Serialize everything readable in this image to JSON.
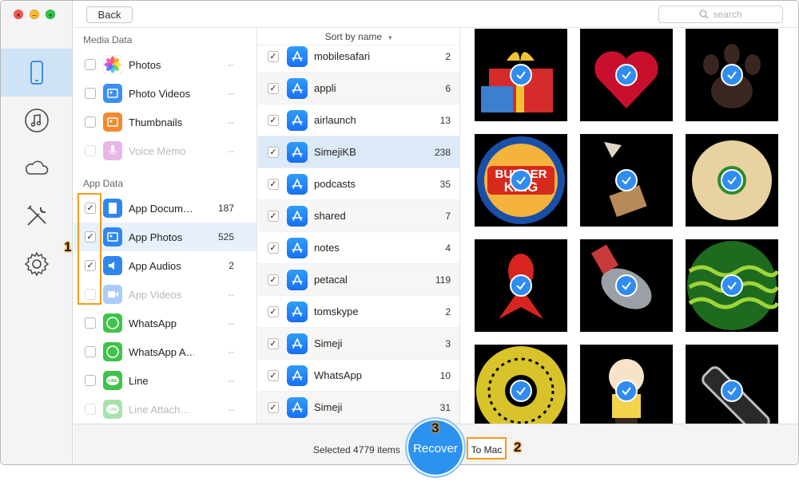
{
  "window": {
    "traffic_lights": [
      "close",
      "minimize",
      "maximize"
    ]
  },
  "sidebar": {
    "items": [
      {
        "name": "device-icon",
        "active": true
      },
      {
        "name": "music-icon",
        "active": false
      },
      {
        "name": "cloud-icon",
        "active": false
      },
      {
        "name": "tools-icon",
        "active": false
      },
      {
        "name": "settings-icon",
        "active": false
      }
    ]
  },
  "toolbar": {
    "back_label": "Back",
    "search_placeholder": "search"
  },
  "categories": {
    "media_header": "Media Data",
    "app_header": "App Data",
    "media": [
      {
        "label": "Photos",
        "count": "--",
        "checked": false,
        "dim": false,
        "icon": "photos-icon",
        "color": "#ffffff"
      },
      {
        "label": "Photo Videos",
        "count": "--",
        "checked": false,
        "dim": false,
        "icon": "photo-videos-icon",
        "color": "#3a8ff0"
      },
      {
        "label": "Thumbnails",
        "count": "--",
        "checked": false,
        "dim": false,
        "icon": "thumbnails-icon",
        "color": "#f28a2e"
      },
      {
        "label": "Voice Memo",
        "count": "--",
        "checked": false,
        "dim": true,
        "icon": "voice-memo-icon",
        "color": "#e9b6e8"
      }
    ],
    "app": [
      {
        "label": "App Docum…",
        "count": "187",
        "checked": true,
        "dim": false,
        "icon": "app-documents-icon",
        "color": "#2f87ee"
      },
      {
        "label": "App Photos",
        "count": "525",
        "checked": true,
        "dim": false,
        "icon": "app-photos-icon",
        "color": "#2f87ee",
        "selected": true
      },
      {
        "label": "App Audios",
        "count": "2",
        "checked": true,
        "dim": false,
        "icon": "app-audios-icon",
        "color": "#2f87ee"
      },
      {
        "label": "App Videos",
        "count": "--",
        "checked": false,
        "dim": true,
        "icon": "app-videos-icon",
        "color": "#a9cdf6"
      },
      {
        "label": "WhatsApp",
        "count": "--",
        "checked": false,
        "dim": false,
        "icon": "whatsapp-icon",
        "color": "#3ec34b"
      },
      {
        "label": "WhatsApp A…",
        "count": "--",
        "checked": false,
        "dim": false,
        "icon": "whatsapp-attachments-icon",
        "color": "#3ec34b"
      },
      {
        "label": "Line",
        "count": "--",
        "checked": false,
        "dim": false,
        "icon": "line-icon",
        "color": "#3ec34b"
      },
      {
        "label": "Line Attach…",
        "count": "--",
        "checked": false,
        "dim": true,
        "icon": "line-attachments-icon",
        "color": "#a8e2ad"
      }
    ]
  },
  "list": {
    "sort_label": "Sort by name",
    "rows": [
      {
        "name": "mobilesafari",
        "count": "2"
      },
      {
        "name": "appli",
        "count": "6"
      },
      {
        "name": "airlaunch",
        "count": "13"
      },
      {
        "name": "SimejiKB",
        "count": "238",
        "selected": true
      },
      {
        "name": "podcasts",
        "count": "35"
      },
      {
        "name": "shared",
        "count": "7"
      },
      {
        "name": "notes",
        "count": "4"
      },
      {
        "name": "petacal",
        "count": "119"
      },
      {
        "name": "tomskype",
        "count": "2"
      },
      {
        "name": "Simeji",
        "count": "3"
      },
      {
        "name": "WhatsApp",
        "count": "10"
      },
      {
        "name": "Simeji",
        "count": "31"
      }
    ]
  },
  "grid": {
    "thumbnails": [
      {
        "name": "gift-sticker",
        "accent": "#d62b2b"
      },
      {
        "name": "heart-sticker",
        "accent": "#c8102e"
      },
      {
        "name": "paw-sticker",
        "accent": "#3a2620"
      },
      {
        "name": "burger-king-sticker",
        "accent": "#1a4fa8"
      },
      {
        "name": "pizza-hand-sticker",
        "accent": "#b88a5a"
      },
      {
        "name": "cookie-sticker",
        "accent": "#e8d2a0"
      },
      {
        "name": "goldfish-sticker",
        "accent": "#d8241f"
      },
      {
        "name": "fish-sticker",
        "accent": "#9aa0a6"
      },
      {
        "name": "watermelon-sticker",
        "accent": "#2d8a2d"
      },
      {
        "name": "sunflower-sticker",
        "accent": "#d8c42a"
      },
      {
        "name": "cartoon-boy-sticker",
        "accent": "#f2d34a"
      },
      {
        "name": "bottle-sticker",
        "accent": "#bfbfbf"
      }
    ]
  },
  "bottom": {
    "selected_text": "Selected 4779 items",
    "recover_label": "Recover",
    "to_mac_label": "To Mac"
  },
  "markers": [
    "1",
    "2",
    "3"
  ]
}
